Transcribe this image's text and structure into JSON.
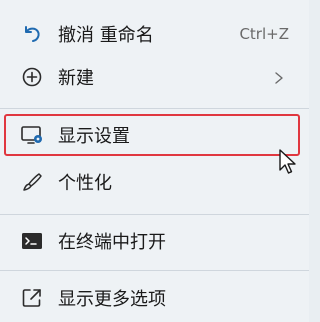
{
  "menu": {
    "items": [
      {
        "label": "撤消 重命名",
        "shortcut": "Ctrl+Z",
        "icon": "undo-icon"
      },
      {
        "label": "新建",
        "icon": "add-circle-icon",
        "has_submenu": true
      },
      {
        "label": "显示设置",
        "icon": "display-settings-icon",
        "highlighted": true
      },
      {
        "label": "个性化",
        "icon": "brush-icon"
      },
      {
        "label": "在终端中打开",
        "icon": "terminal-icon"
      },
      {
        "label": "显示更多选项",
        "icon": "share-icon"
      }
    ]
  },
  "colors": {
    "accent": "#1f6ab0",
    "highlight_border": "#e0373f",
    "background": "#eef2f5"
  }
}
